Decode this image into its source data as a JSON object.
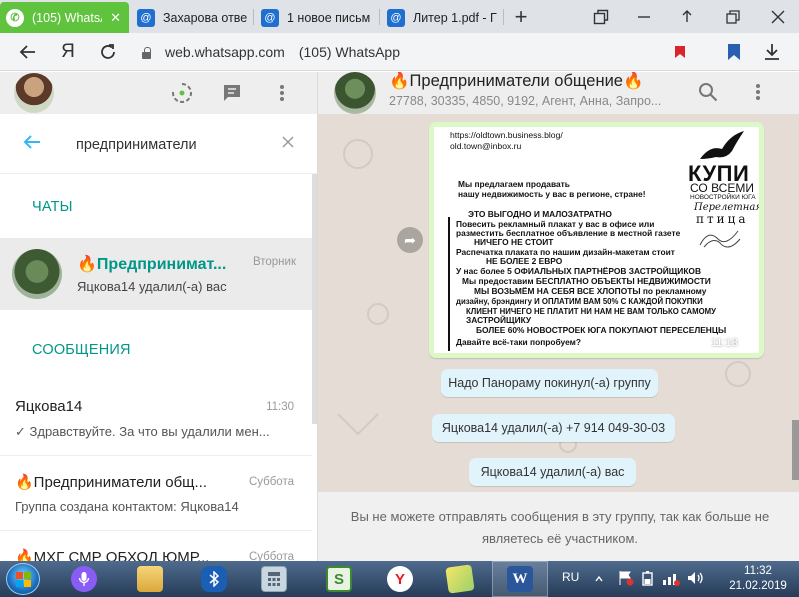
{
  "browser": {
    "tabs": [
      {
        "title": "(105) WhatsApp",
        "icon": "whatsapp-icon",
        "active": true
      },
      {
        "title": "Захарова отве",
        "icon": "mail-icon",
        "active": false
      },
      {
        "title": "1 новое письм",
        "icon": "mail-icon",
        "active": false
      },
      {
        "title": "Литер 1.pdf - Г",
        "icon": "mail-icon",
        "active": false
      }
    ],
    "new_tab": "+",
    "address": {
      "host": "web.whatsapp.com",
      "page_title": "(105) WhatsApp"
    },
    "yandex_letter": "Я"
  },
  "sidebar": {
    "search_query": "предприниматели",
    "chats_header": "ЧАТЫ",
    "messages_header": "СООБЩЕНИЯ",
    "chat_result": {
      "name": "🔥Предпринимат...",
      "time": "Вторник",
      "preview": "Яцкова14 удалил(-а) вас"
    },
    "messages": [
      {
        "title": "Яцкова14",
        "time": "11:30",
        "snippet": "✓ Здравствуйте. За что вы удалили мен..."
      },
      {
        "title": "🔥Предприниматели общ...",
        "time": "Суббота",
        "snippet": "Группа создана контактом: Яцкова14"
      },
      {
        "title": "🔥МХГ СМР ОБХОД ЮМР...",
        "time": "Суббота",
        "snippet": ""
      }
    ]
  },
  "conversation": {
    "title": "🔥Предприниматели общение🔥",
    "members": "27788, 30335, 4850, 9192, Агент, Анна, Запро...",
    "image_message": {
      "time": "11:18",
      "poster": {
        "url_line": "https://oldtown.business.blog/",
        "email_line": "old.town@inbox.ru",
        "brand_big": "КУПИ",
        "brand_2": "СО ВСЕМИ",
        "brand_3": "НОВОСТРОЙКИ ЮГА",
        "brand_4": "Перелетная",
        "brand_5": "птица",
        "lines": [
          "Мы предлагаем продавать",
          "нашу недвижимость у вас в регионе, стране!",
          "ЭТО ВЫГОДНО И МАЛОЗАТРАТНО",
          "Повесить рекламный плакат у вас в офисе или",
          "разместить бесплатное объявление в местной газете",
          "НИЧЕГО НЕ СТОИТ",
          "Распечатка плаката по нашим дизайн-макетам стоит",
          "НЕ БОЛЕЕ 2 ЕВРО",
          "У нас более 5 ОФИАЛЬНЫХ ПАРТНЁРОВ ЗАСТРОЙЩИКОВ",
          "Мы предоставим БЕСПЛАТНО ОБЪЕКТЫ НЕДВИЖИМОСТИ",
          "МЫ ВОЗЬМЁМ НА СЕБЯ ВСЕ ХЛОПОТЫ по рекламному",
          "дизайну, брэндингу И ОПЛАТИМ ВАМ 50% С КАЖДОЙ ПОКУПКИ",
          "КЛИЕНТ НИЧЕГО НЕ ПЛАТИТ НИ НАМ НЕ ВАМ ТОЛЬКО САМОМУ",
          "ЗАСТРОЙЩИКУ",
          "БОЛЕЕ 60% НОВОСТРОЕК ЮГА ПОКУПАЮТ ПЕРЕСЕЛЕНЦЫ",
          "Давайте всё-таки попробуем?"
        ]
      }
    },
    "system_messages": [
      "Надо Панораму покинул(-а) группу",
      "Яцкова14 удалил(-а) +7 914 049-30-03",
      "Яцкова14 удалил(-а) вас"
    ],
    "footer_notice": "Вы не можете отправлять сообщения в эту группу, так как больше не являетесь её участником."
  },
  "taskbar": {
    "language": "RU",
    "time": "11:32",
    "date": "21.02.2019"
  },
  "colors": {
    "whatsapp_green": "#5fc33d",
    "teal": "#009688",
    "outgoing_bubble": "#dcf8c6",
    "system_bubble": "#e1f3fb",
    "chat_background": "#e5ddd5"
  }
}
